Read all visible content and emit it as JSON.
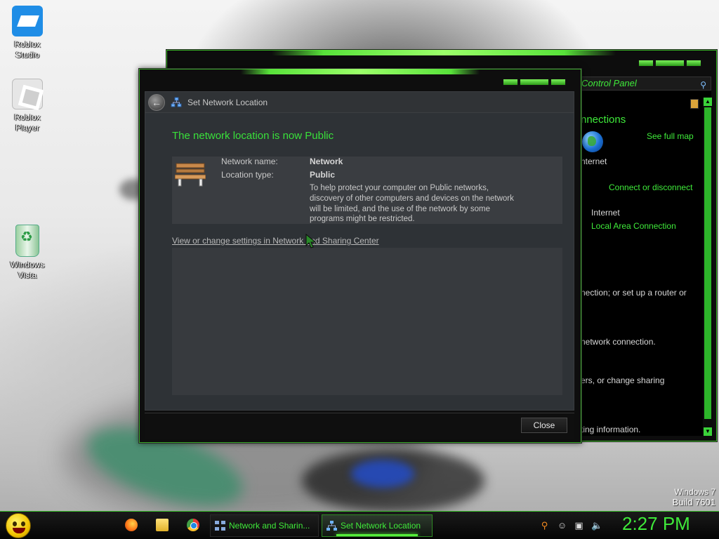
{
  "desktop": {
    "icons": [
      {
        "label_line1": "Roblox",
        "label_line2": "Studio"
      },
      {
        "label_line1": "Roblox",
        "label_line2": "Player"
      },
      {
        "label_line1": "Windows",
        "label_line2": "Vista"
      }
    ]
  },
  "control_panel": {
    "address": "Control Panel",
    "heading": "nnections",
    "see_full_map": "See full map",
    "internet_short": "nternet",
    "connect_or_disconnect": "Connect or disconnect",
    "access_type_value": "Internet",
    "connection_link": "Local Area Connection",
    "task1_text": "nection; or set up a router or",
    "task2_text": "network connection.",
    "task3_text": "ers, or change sharing",
    "task4_text": "ting information."
  },
  "dialog": {
    "nav_title": "Set Network Location",
    "headline": "The network location is now Public",
    "network_name_label": "Network name:",
    "network_name_value": "Network",
    "location_type_label": "Location type:",
    "location_type_value": "Public",
    "description": "To help protect your computer on Public networks, discovery of other computers and devices on the network will be limited, and the use of the network by some programs might be restricted.",
    "settings_link": "View or change settings in Network and Sharing Center",
    "close_button": "Close"
  },
  "watermark": {
    "line1": "Windows 7",
    "line2": "Build 7601"
  },
  "taskbar": {
    "tasks": [
      {
        "label": "Network and Sharin..."
      },
      {
        "label": "Set Network Location"
      }
    ],
    "clock": "2:27 PM"
  },
  "colors": {
    "accent_green": "#3fea3a",
    "dialog_bg": "#2e3236",
    "taskbar_bg": "#050505"
  }
}
